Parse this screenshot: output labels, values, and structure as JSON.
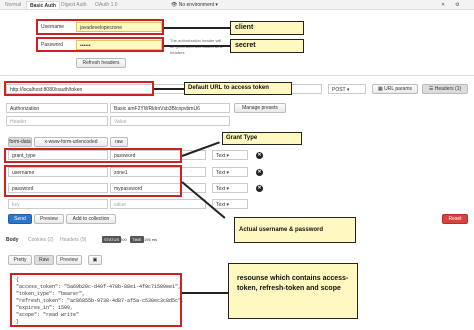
{
  "top_tabs": [
    {
      "label": "Normal",
      "active": false
    },
    {
      "label": "Basic Auth",
      "active": true
    },
    {
      "label": "Digest Auth",
      "active": false
    },
    {
      "label": "OAuth 1.0",
      "active": false
    }
  ],
  "environment": {
    "label": "No environment"
  },
  "auth": {
    "username_label": "Username",
    "username_value": "javadeveloperzone",
    "password_label": "Password",
    "password_value": "••••••",
    "help_text_1": "The authorization header will",
    "help_text_2": "be generated and added as a",
    "help_text_3": "headers",
    "refresh_button": "Refresh headers"
  },
  "request": {
    "url": "http://localhost:8080/oauth/token",
    "method": "POST",
    "url_params_button": "URL params",
    "headers_button": "Headers (1)"
  },
  "headers": {
    "authorization_key": "Authorization",
    "authorization_value": "Basic amF2YWRldmVsb3BlcnpvbmU6",
    "manage_presets": "Manage presets",
    "header_placeholder": "Header",
    "value_placeholder": "Value"
  },
  "body_tabs": [
    "form-data",
    "x-www-form-urlencoded",
    "raw"
  ],
  "body_params": [
    {
      "key": "grant_type",
      "value": "password",
      "type": "Text"
    },
    {
      "key": "username",
      "value": "zone1",
      "type": "Text"
    },
    {
      "key": "password",
      "value": "mypassword",
      "type": "Text"
    },
    {
      "key": "key",
      "value": "value",
      "type": "Text"
    }
  ],
  "actions": {
    "send": "Send",
    "preview": "Preview",
    "add_collection": "Add to collection",
    "reset": "Reset"
  },
  "response_tabs": {
    "body": "Body",
    "cookies": "Cookies (2)",
    "headers": "Headers (9)",
    "status_label": "STATUS",
    "status_value": "200",
    "time_label": "TIME",
    "time_value": "196 ms"
  },
  "view_buttons": [
    "Pretty",
    "Raw",
    "Preview"
  ],
  "response_body": [
    "{",
    "  \"access_token\": \"5a69b20c-d40f-478b-88e1-4f9c71589ee1\",",
    "  \"token_type\": \"bearer\",",
    "  \"refresh_token\": \"ac86855b-9738-4d87-af5a-c530ec3c8d5c\",",
    "  \"expires_in\": 1599,",
    "  \"scope\": \"read write\"",
    "}"
  ],
  "callouts": {
    "client": "client",
    "secret": "secret",
    "default_url": "Default URL to access token",
    "grant_type": "Grant Type",
    "actual_credentials": "Actual username & password",
    "resource": "resounse which contains access-token, refresh-token and scope"
  },
  "accent_colors": {
    "annotation_red": "#cc2222",
    "callout_yellow": "#fff8c0",
    "send_blue": "#2a76c9",
    "reset_red": "#d9433f"
  }
}
